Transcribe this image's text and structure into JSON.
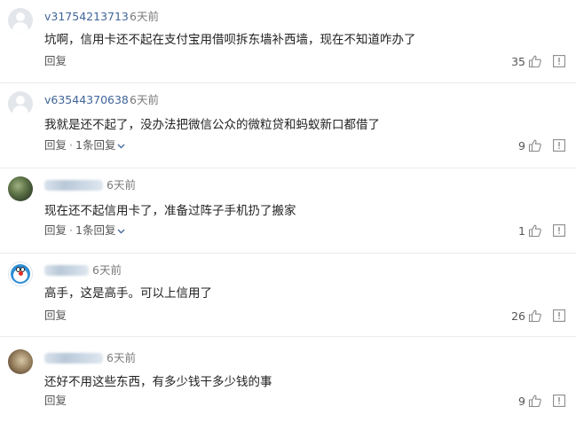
{
  "comments": [
    {
      "username": "v31754213713",
      "time": "6天前",
      "text": "坑啊，信用卡还不起在支付宝用借呗拆东墙补西墙，现在不知道咋办了",
      "reply_label": "回复",
      "reply_count_label": "",
      "likes": "35",
      "avatar_icon": "default-avatar-icon"
    },
    {
      "username": "v63544370638",
      "time": "6天前",
      "text": "我就是还不起了，没办法把微信公众的微粒贷和蚂蚁新口都借了",
      "reply_label": "回复",
      "reply_count_label": "1条回复",
      "likes": "9",
      "avatar_icon": "default-avatar-icon"
    },
    {
      "username": "",
      "time": "6天前",
      "text": "现在还不起信用卡了，准备过阵子手机扔了搬家",
      "reply_label": "回复",
      "reply_count_label": "1条回复",
      "likes": "1",
      "avatar_icon": "photo-avatar-icon"
    },
    {
      "username": "",
      "time": "6天前",
      "text": "高手，这是高手。可以上信用了",
      "reply_label": "回复",
      "reply_count_label": "",
      "likes": "26",
      "avatar_icon": "doraemon-avatar-icon"
    },
    {
      "username": "",
      "time": "6天前",
      "text": "还好不用这些东西，有多少钱干多少钱的事",
      "reply_label": "回复",
      "reply_count_label": "",
      "likes": "9",
      "avatar_icon": "photo-avatar-icon"
    }
  ],
  "colors": {
    "username": "#406599",
    "meta": "#7a7a7a",
    "text": "#222222",
    "divider": "#ececec"
  },
  "icons": {
    "like": "thumbs-up-icon",
    "report": "report-icon",
    "expand": "chevron-down-icon"
  },
  "separator": "·"
}
